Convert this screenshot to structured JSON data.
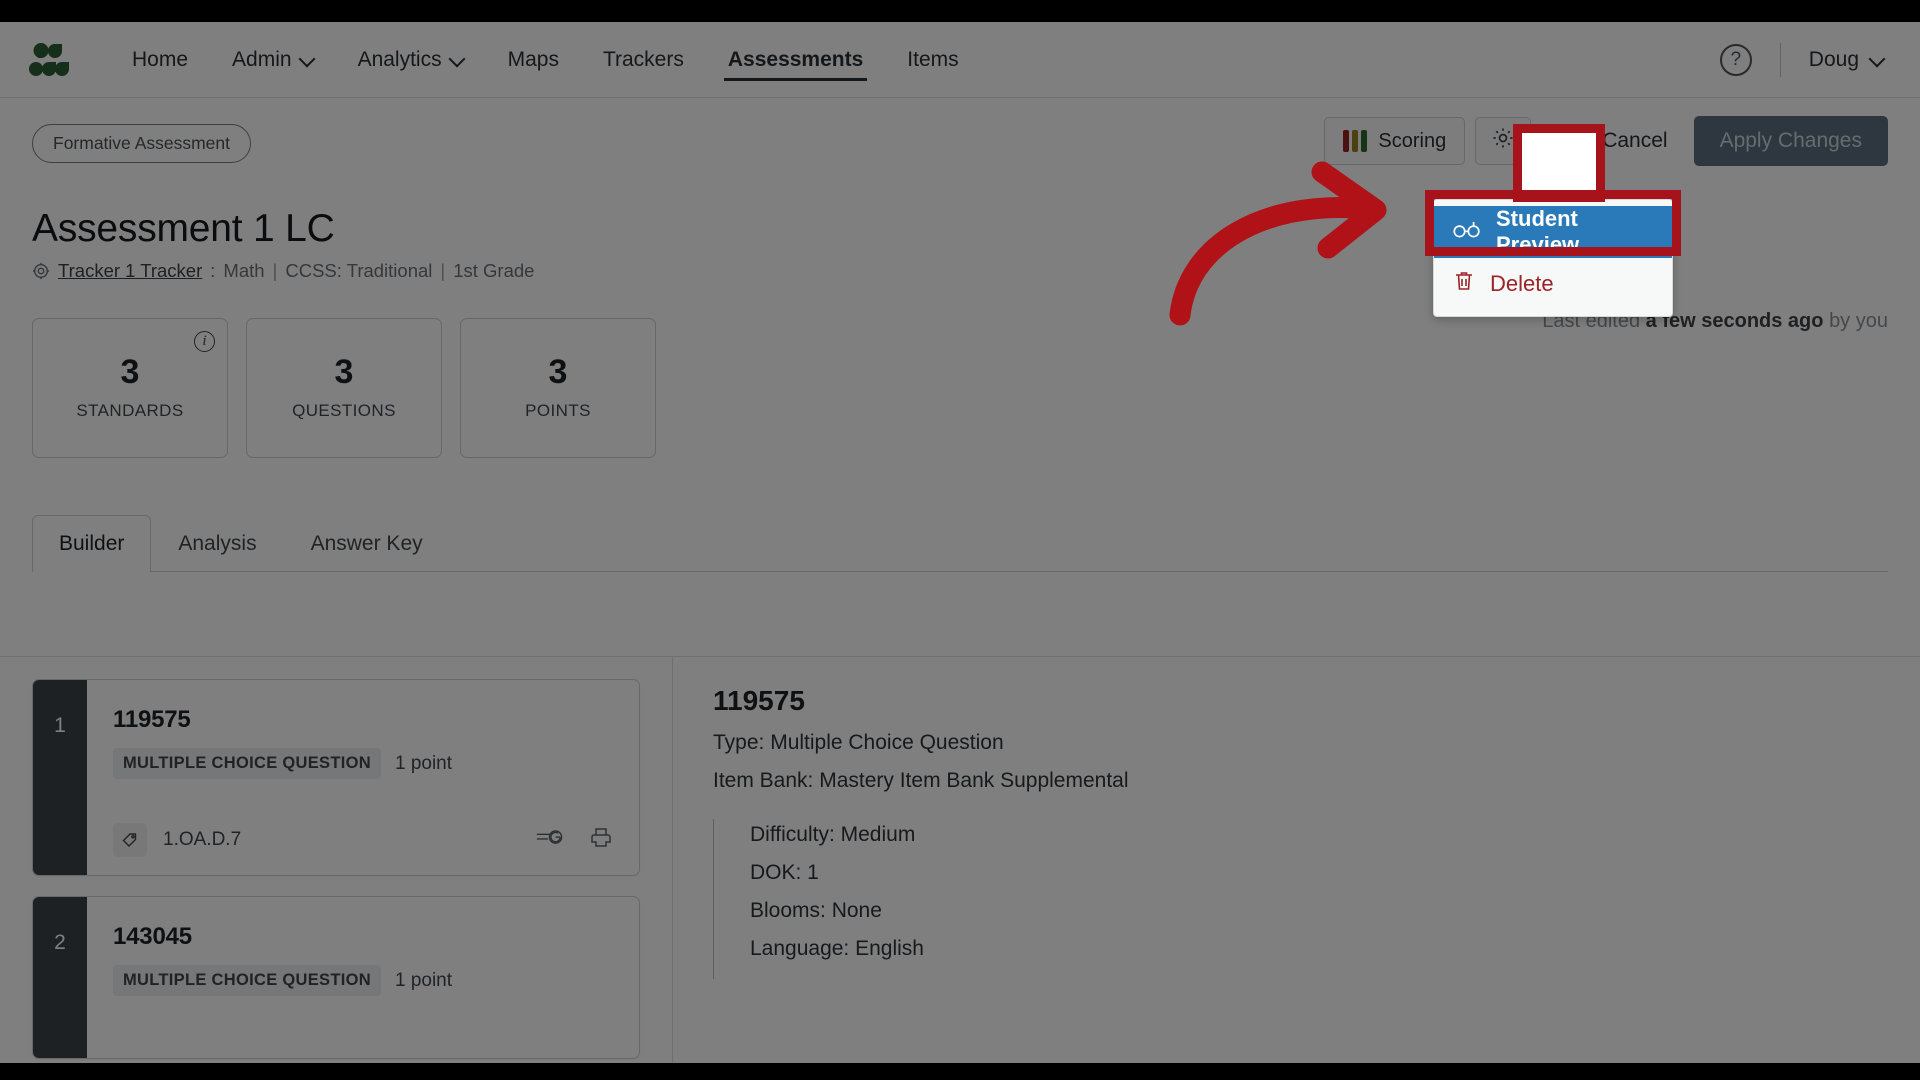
{
  "nav": {
    "logo_name": "mastery-connect-logo",
    "items": [
      {
        "label": "Home",
        "caret": false,
        "active": false
      },
      {
        "label": "Admin",
        "caret": true,
        "active": false
      },
      {
        "label": "Analytics",
        "caret": true,
        "active": false
      },
      {
        "label": "Maps",
        "caret": false,
        "active": false
      },
      {
        "label": "Trackers",
        "caret": false,
        "active": false
      },
      {
        "label": "Assessments",
        "caret": false,
        "active": true
      },
      {
        "label": "Items",
        "caret": false,
        "active": false
      }
    ],
    "help_label": "?",
    "user_label": "Doug"
  },
  "header": {
    "pill": "Formative Assessment",
    "title": "Assessment 1 LC",
    "tracker_link": "Tracker 1 Tracker",
    "colon": ":",
    "subject": "Math",
    "sep1": "|",
    "standard_set": "CCSS: Traditional",
    "sep2": "|",
    "grade": "1st Grade",
    "last_edit_prefix": "Last edited",
    "last_edit_time": "a few seconds ago",
    "last_edit_suffix": "by you"
  },
  "toolbar": {
    "scoring_label": "Scoring",
    "scoring_bar_colors": [
      "#9b2220",
      "#9b8020",
      "#2c6b2c"
    ],
    "settings_icon": "gear-icon",
    "more_icon": "kebab-menu-icon",
    "cancel_label": "Cancel",
    "apply_label": "Apply Changes",
    "apply_bg": "#5c6f81"
  },
  "menu": {
    "items": [
      {
        "label": "Student Preview",
        "icon": "glasses-icon",
        "state": "selected"
      },
      {
        "label": "Delete",
        "icon": "trash-icon",
        "state": "danger"
      }
    ],
    "selected_bg": "#2a7ab9",
    "danger_color": "#9b2226"
  },
  "stats": [
    {
      "num": "3",
      "label": "STANDARDS",
      "info": true
    },
    {
      "num": "3",
      "label": "QUESTIONS",
      "info": false
    },
    {
      "num": "3",
      "label": "POINTS",
      "info": false
    }
  ],
  "tabs": [
    {
      "label": "Builder",
      "active": true
    },
    {
      "label": "Analysis",
      "active": false
    },
    {
      "label": "Answer Key",
      "active": false
    }
  ],
  "questions": [
    {
      "index": "1",
      "id": "119575",
      "type": "MULTIPLE CHOICE QUESTION",
      "points": "1 point",
      "standard": "1.OA.D.7"
    },
    {
      "index": "2",
      "id": "143045",
      "type": "MULTIPLE CHOICE QUESTION",
      "points": "1 point",
      "standard": ""
    }
  ],
  "detail": {
    "id": "119575",
    "type_line": "Type: Multiple Choice Question",
    "bank_line": "Item Bank: Mastery Item Bank Supplemental",
    "difficulty": "Difficulty: Medium",
    "dok": "DOK: 1",
    "blooms": "Blooms: None",
    "language": "Language: English"
  },
  "annotations": {
    "highlight_color": "#a6131a",
    "arrow_name": "red-curved-arrow"
  }
}
